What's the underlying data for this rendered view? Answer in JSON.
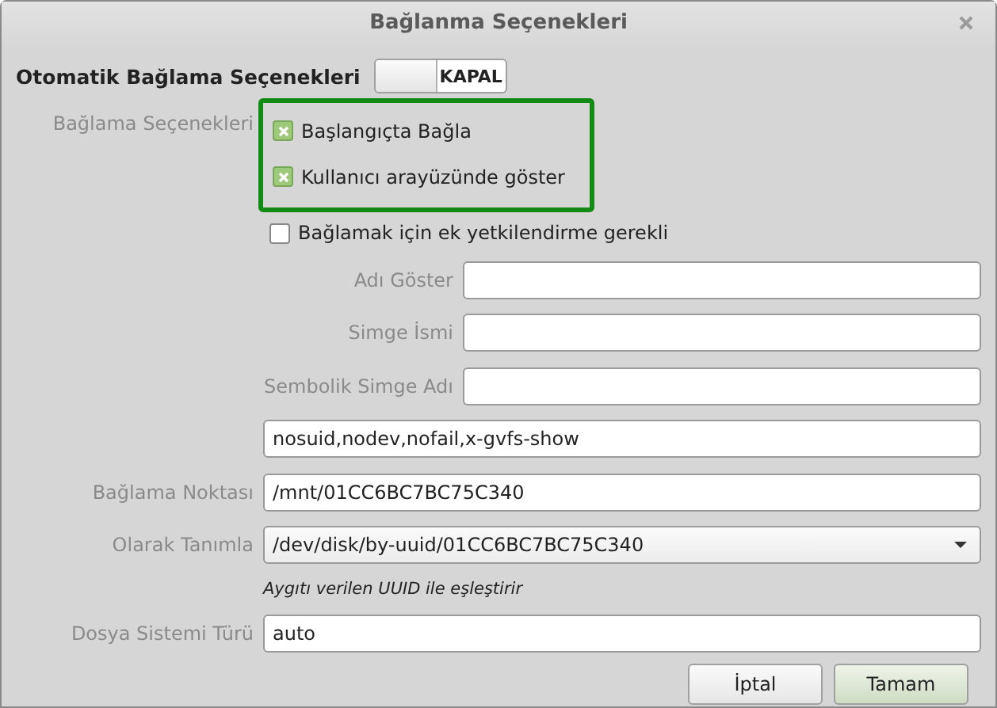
{
  "window": {
    "title": "Bağlanma Seçenekleri"
  },
  "auto_mount": {
    "label": "Otomatik Bağlama Seçenekleri",
    "switch": {
      "on": false,
      "text": "KAPAL"
    }
  },
  "mount_options": {
    "label": "Bağlama Seçenekleri",
    "highlight": true,
    "checkboxes": [
      {
        "label": "Başlangıçta Bağla",
        "checked": true
      },
      {
        "label": "Kullanıcı arayüzünde göster",
        "checked": true
      },
      {
        "label": "Bağlamak için ek yetkilendirme gerekli",
        "checked": false
      }
    ]
  },
  "name_fields": [
    {
      "label": "Adı Göster"
    },
    {
      "label": "Simge İsmi"
    },
    {
      "label": "Sembolik Simge Adı"
    }
  ],
  "options_value": "nosuid,nodev,nofail,x-gvfs-show",
  "fields": [
    {
      "kind": "text",
      "label": "Bağlama Noktası",
      "value": "/mnt/01CC6BC7BC75C340"
    },
    {
      "kind": "dropdown",
      "label": "Olarak Tanımla",
      "value": "/dev/disk/by-uuid/01CC6BC7BC75C340",
      "hint": "Aygıtı verilen UUID ile eşleştirir"
    },
    {
      "kind": "text",
      "label": "Dosya Sistemi Türü",
      "value": "auto"
    }
  ],
  "buttons": [
    {
      "label": "İptal",
      "default": false
    },
    {
      "label": "Tamam",
      "default": true
    }
  ]
}
